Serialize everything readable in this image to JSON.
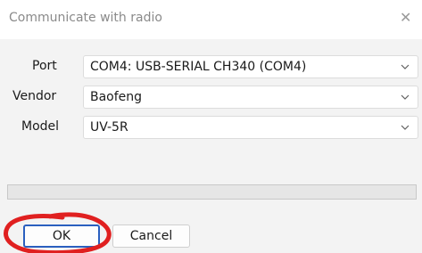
{
  "window": {
    "title": "Communicate with radio",
    "close_symbol": "✕"
  },
  "form": {
    "port": {
      "label": "Port",
      "value": "COM4: USB-SERIAL CH340 (COM4)"
    },
    "vendor": {
      "label": "Vendor",
      "value": "Baofeng"
    },
    "model": {
      "label": "Model",
      "value": "UV-5R"
    }
  },
  "progress": {
    "value": 0
  },
  "buttons": {
    "ok_label": "OK",
    "cancel_label": "Cancel"
  },
  "annotation": {
    "color": "#e02020",
    "shape": "hand-drawn ellipse around OK button"
  },
  "icons": {
    "close": "close-icon",
    "dropdown": "chevron-down-icon"
  }
}
